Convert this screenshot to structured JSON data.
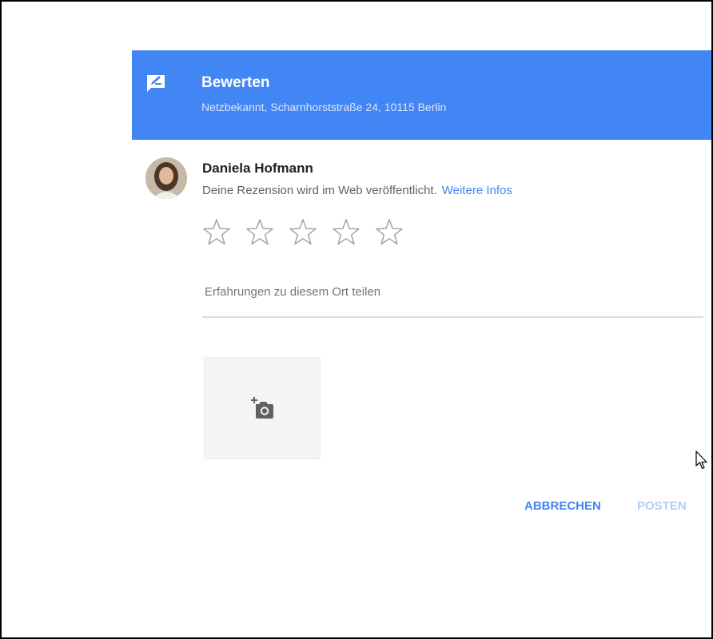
{
  "header": {
    "title": "Bewerten",
    "subtitle": "Netzbekannt, Scharnhorststraße 24, 10115 Berlin",
    "icon": "rate-review-icon",
    "color": "#4285f4"
  },
  "user": {
    "name": "Daniela Hofmann",
    "notice": "Deine Rezension wird im Web veröffentlicht.",
    "more_link": "Weitere Infos"
  },
  "rating": {
    "max": 5,
    "value": 0,
    "icon": "star-outline-icon"
  },
  "review": {
    "placeholder": "Erfahrungen zu diesem Ort teilen",
    "value": ""
  },
  "photo": {
    "icon": "add-photo-icon"
  },
  "actions": {
    "cancel_label": "ABBRECHEN",
    "post_label": "POSTEN",
    "cancel_color": "#4285f4",
    "post_color_disabled": "#b3cdf7"
  }
}
